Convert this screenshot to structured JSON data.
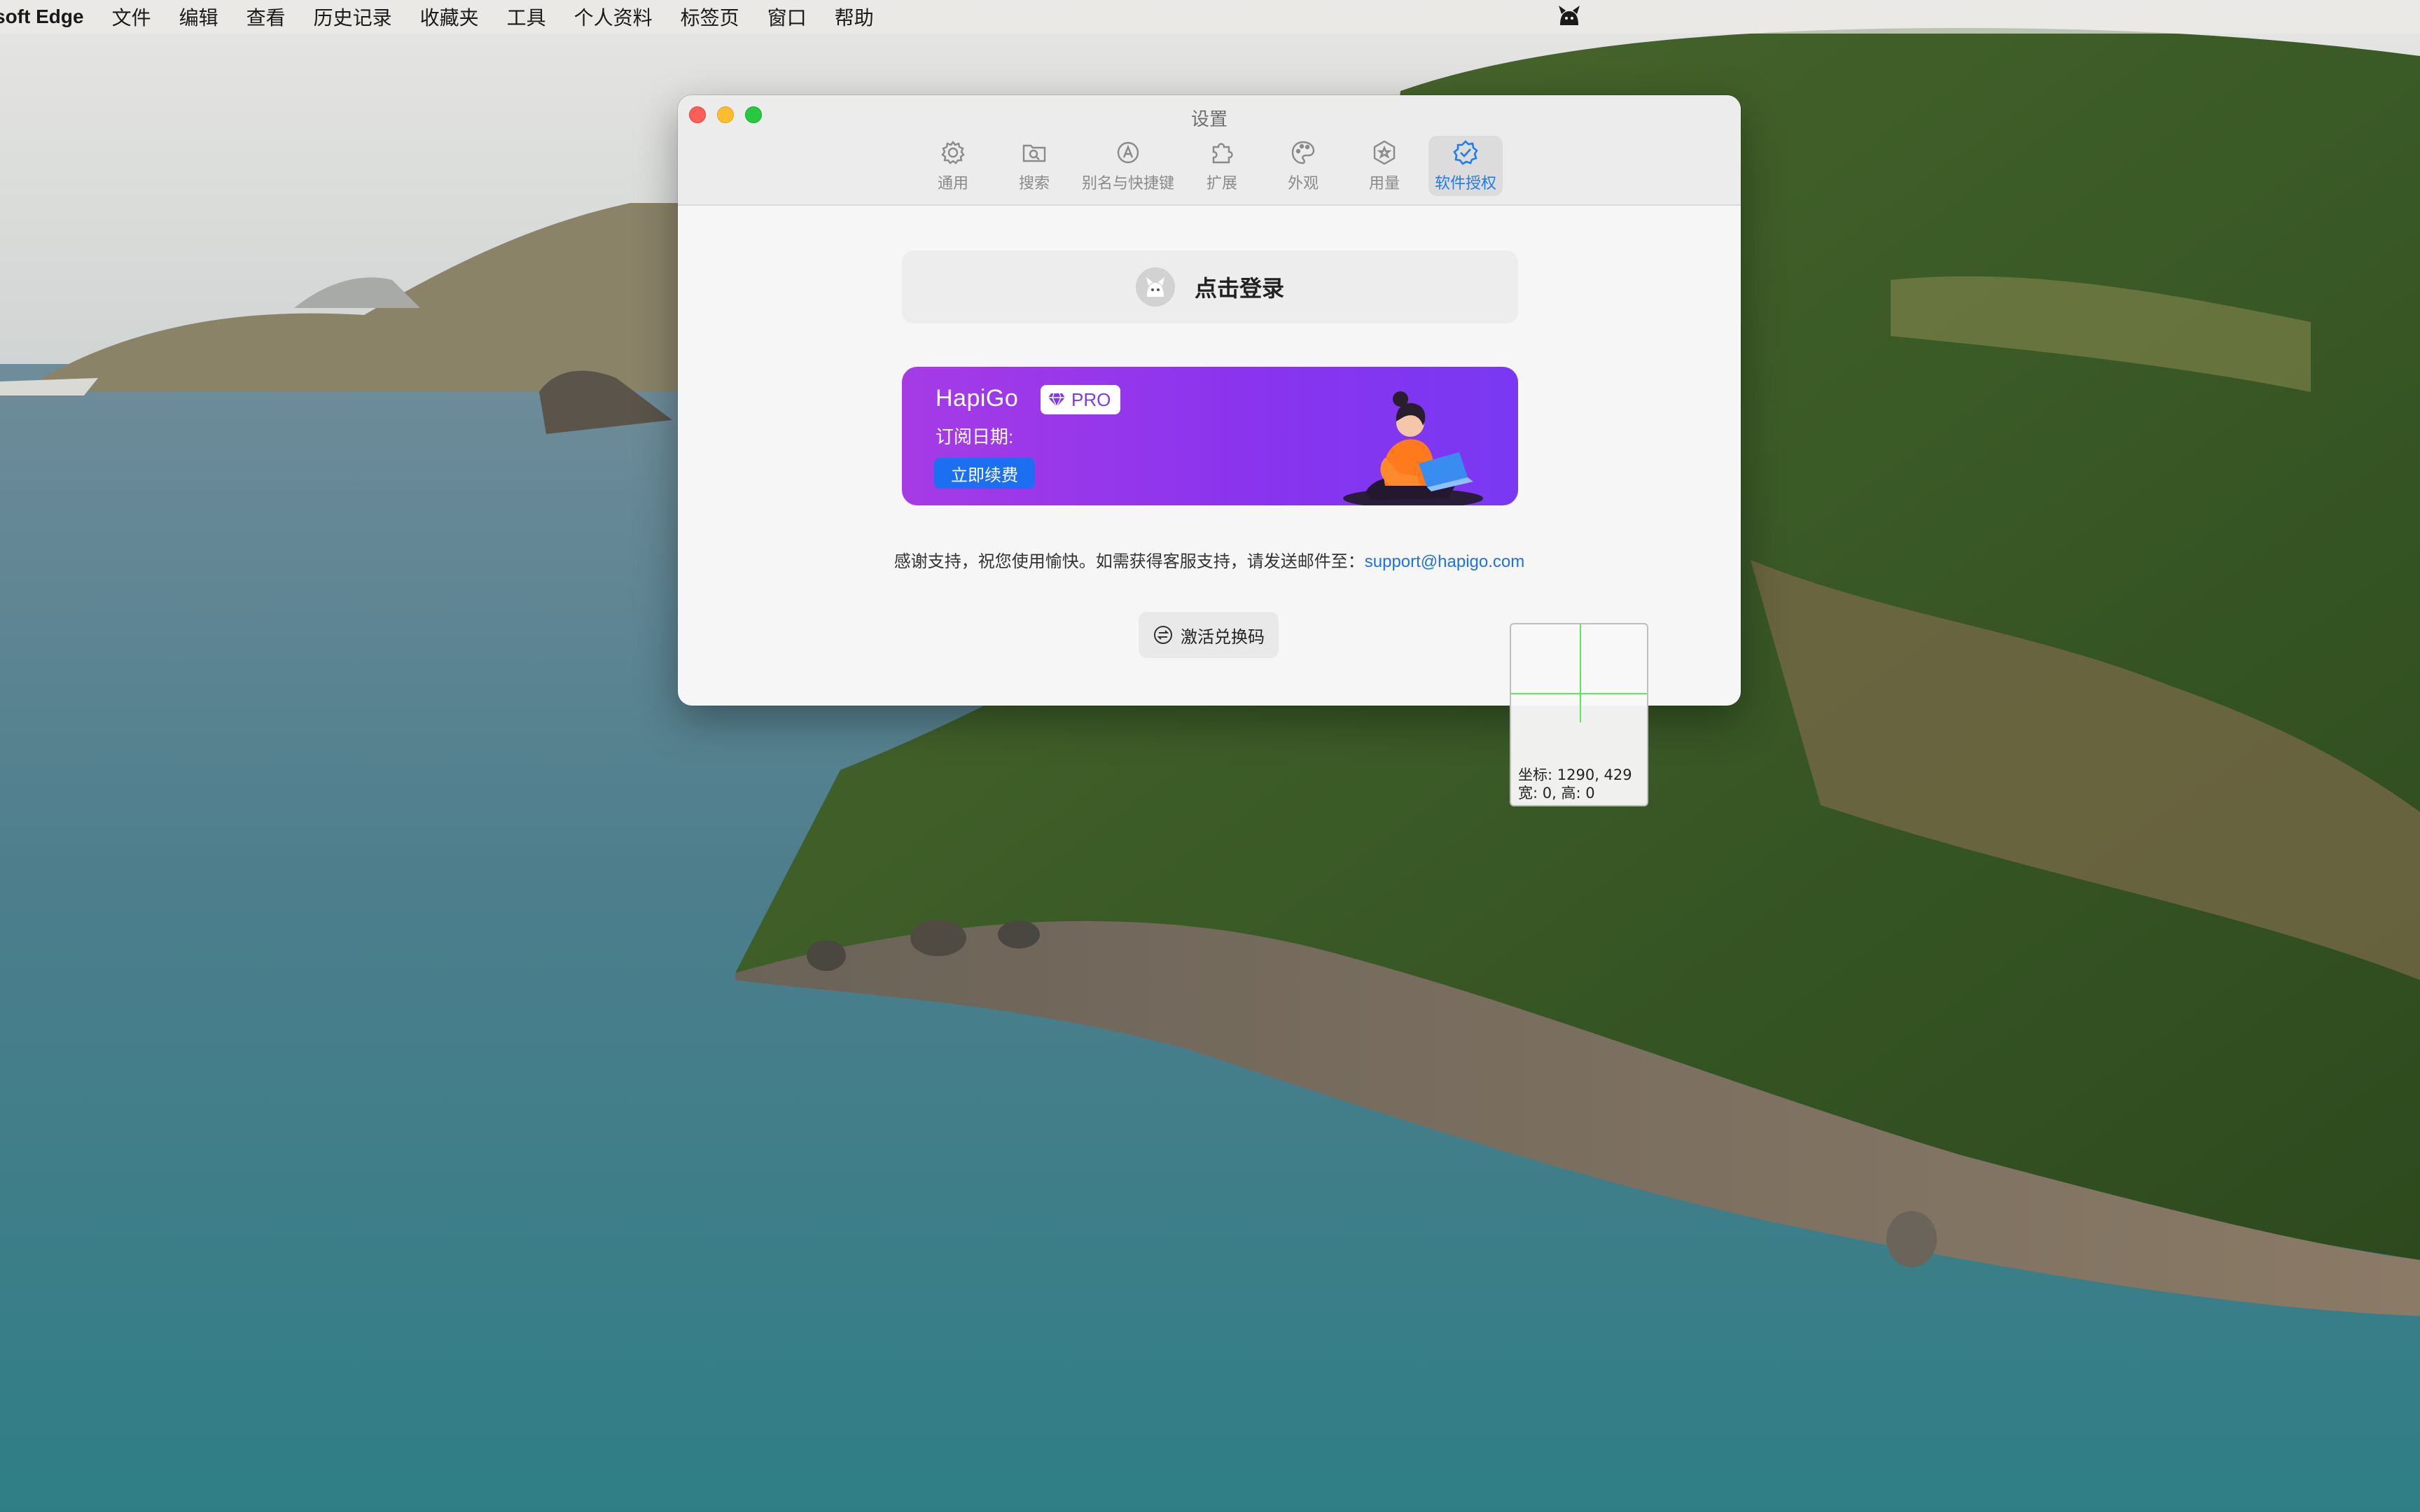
{
  "menubar": {
    "app_name": "soft Edge",
    "items": [
      "文件",
      "编辑",
      "查看",
      "历史记录",
      "收藏夹",
      "工具",
      "个人资料",
      "标签页",
      "窗口",
      "帮助"
    ],
    "status_icon": "mascot-icon"
  },
  "window": {
    "title": "设置",
    "tabs": [
      {
        "label": "通用",
        "icon": "gear-icon"
      },
      {
        "label": "搜索",
        "icon": "folder-search-icon"
      },
      {
        "label": "别名与快捷键",
        "icon": "alias-a-icon"
      },
      {
        "label": "扩展",
        "icon": "puzzle-icon"
      },
      {
        "label": "外观",
        "icon": "palette-icon"
      },
      {
        "label": "用量",
        "icon": "hexagon-star-icon"
      },
      {
        "label": "软件授权",
        "icon": "verified-badge-icon",
        "active": true
      }
    ],
    "login_label": "点击登录",
    "pro_card": {
      "brand": "HapiGo",
      "badge": "PRO",
      "subscription_label": "订阅日期:",
      "renew_label": "立即续费"
    },
    "support_text": "感谢支持，祝您使用愉快。如需获得客服支持，请发送邮件至：",
    "support_email": "support@hapigo.com",
    "redeem_label": "激活兑换码"
  },
  "coord_overlay": {
    "coords_line": "坐标: 1290, 429",
    "size_line": "宽: 0, 高: 0"
  },
  "colors": {
    "accent": "#1f7cf0",
    "pro_gradient_start": "#a63be6",
    "pro_gradient_end": "#7a38f2",
    "renew_button": "#1d6ff2"
  }
}
